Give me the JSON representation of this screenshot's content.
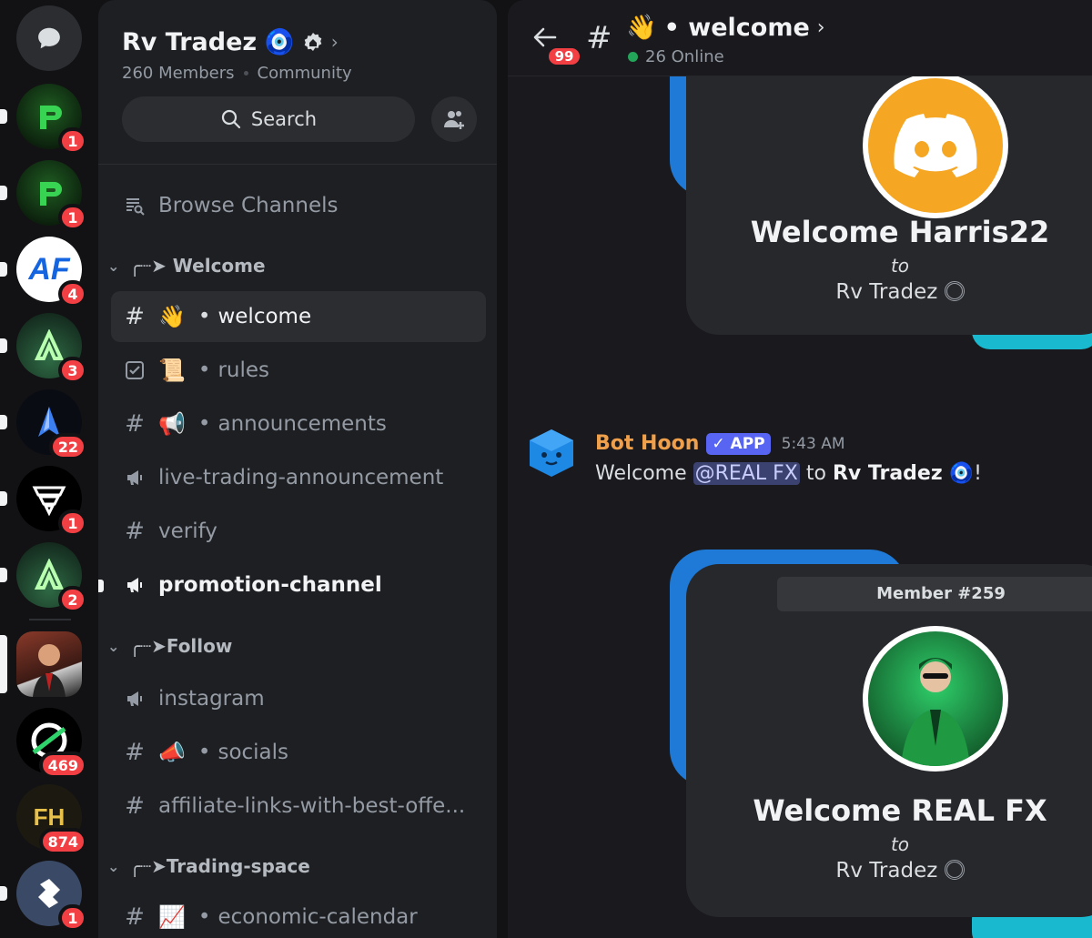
{
  "rail": {
    "servers": [
      {
        "name": "direct-messages",
        "badge": ""
      },
      {
        "name": "server-p-1",
        "badge": "1"
      },
      {
        "name": "server-p-2",
        "badge": "1"
      },
      {
        "name": "server-af",
        "badge": "4",
        "initials": "AF"
      },
      {
        "name": "server-a-1",
        "badge": "3"
      },
      {
        "name": "server-arrow",
        "badge": "22"
      },
      {
        "name": "server-cft",
        "badge": "1"
      },
      {
        "name": "server-a-2",
        "badge": "2"
      },
      {
        "name": "server-rv-tradez",
        "badge": ""
      },
      {
        "name": "server-ring",
        "badge": "469"
      },
      {
        "name": "server-fh",
        "badge": "874",
        "initials": "FH"
      },
      {
        "name": "server-flame",
        "badge": "1"
      }
    ]
  },
  "sidebar": {
    "server_name": "Rv Tradez",
    "server_emoji": "🧿",
    "members": "260 Members",
    "type": "Community",
    "search_label": "Search",
    "browse_label": "Browse Channels",
    "categories": [
      {
        "label": "╭┈➤ Welcome"
      },
      {
        "label": "╭┈➤Follow"
      },
      {
        "label": "╭┈➤Trading-space"
      }
    ],
    "channels": {
      "welcome": {
        "emoji": "👋",
        "name": "welcome"
      },
      "rules": {
        "emoji": "📜",
        "name": "rules"
      },
      "announcements": {
        "emoji": "📢",
        "name": "announcements"
      },
      "live_trading": {
        "name": "live-trading-announcement"
      },
      "verify": {
        "name": "verify"
      },
      "promotion": {
        "name": "promotion-channel"
      },
      "instagram": {
        "name": "instagram"
      },
      "socials": {
        "emoji": "📣",
        "name": "socials"
      },
      "affiliate": {
        "name": "affiliate-links-with-best-offe..."
      },
      "economic": {
        "emoji": "📈",
        "name": "economic-calendar"
      }
    },
    "bullet": "•"
  },
  "chat": {
    "back_badge": "99",
    "channel_emoji": "👋",
    "channel_name": "• welcome",
    "online": "26 Online",
    "card1": {
      "title": "Welcome Harris22",
      "to": "to",
      "server": "Rv Tradez"
    },
    "message": {
      "author": "Bot Hoon",
      "app_tag": "✓ APP",
      "time": "5:43 AM",
      "prefix": "Welcome",
      "mention": "@REAL FX",
      "middle": "to",
      "server": "Rv Tradez",
      "emoji": "🧿",
      "suffix": "!"
    },
    "card2": {
      "member": "Member #259",
      "title": "Welcome REAL FX",
      "to": "to",
      "server": "Rv Tradez"
    }
  },
  "colors": {
    "accent": "#5865f2",
    "badge": "#f23f43",
    "online": "#23a55a",
    "card_blue": "#1e7ad6",
    "card_teal": "#19b9cf",
    "author": "#f0a04b"
  }
}
